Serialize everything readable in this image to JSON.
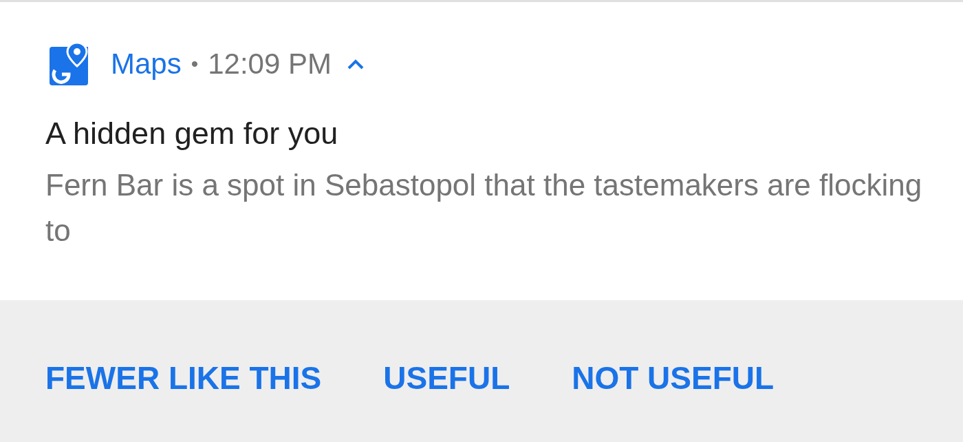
{
  "notification": {
    "app_name": "Maps",
    "separator": "•",
    "time": "12:09 PM",
    "expanded": true,
    "title": "A hidden gem for you",
    "body": "Fern Bar is a spot in Sebastopol that the tastemakers are flocking to"
  },
  "actions": [
    {
      "label": "FEWER LIKE THIS"
    },
    {
      "label": "USEFUL"
    },
    {
      "label": "NOT USEFUL"
    }
  ]
}
